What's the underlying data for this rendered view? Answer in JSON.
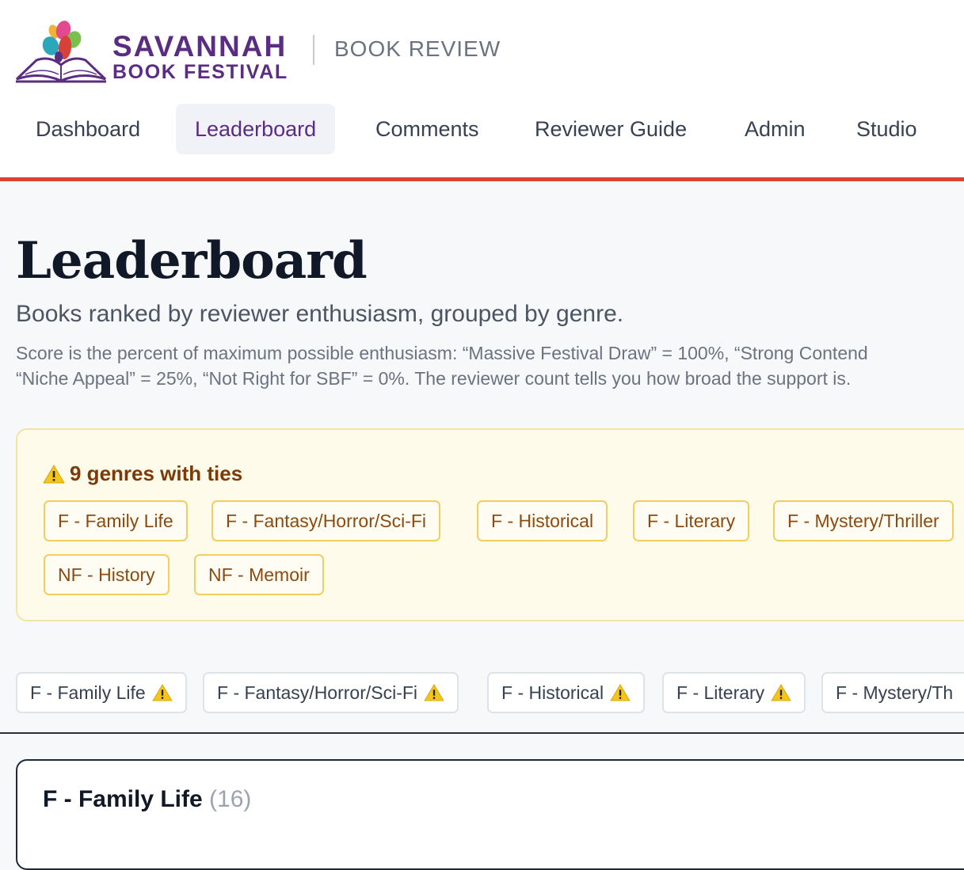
{
  "brand": {
    "line1": "SAVANNAH",
    "line2": "BOOK FESTIVAL",
    "section": "BOOK REVIEW",
    "color": "#5a2d82"
  },
  "nav": {
    "tabs": [
      {
        "label": "Dashboard",
        "active": false
      },
      {
        "label": "Leaderboard",
        "active": true
      },
      {
        "label": "Comments",
        "active": false
      },
      {
        "label": "Reviewer Guide",
        "active": false
      },
      {
        "label": "Admin",
        "active": false
      },
      {
        "label": "Studio",
        "active": false
      }
    ]
  },
  "page": {
    "title": "Leaderboard",
    "subtitle": "Books ranked by reviewer enthusiasm, grouped by genre.",
    "note_line1": "Score is the percent of maximum possible enthusiasm: “Massive Festival Draw” = 100%, “Strong Contend",
    "note_line2": "“Niche Appeal” = 25%, “Not Right for SBF” = 0%. The reviewer count tells you how broad the support is."
  },
  "ties": {
    "title": "9 genres with ties",
    "genres": [
      "F - Family Life",
      "F - Fantasy/Horror/Sci-Fi",
      "F - Historical",
      "F - Literary",
      "F - Mystery/Thriller",
      "NF - History",
      "NF - Memoir"
    ]
  },
  "genre_tabs": [
    "F - Family Life",
    "F - Fantasy/Horror/Sci-Fi",
    "F - Historical",
    "F - Literary",
    "F - Mystery/Th"
  ],
  "section": {
    "title": "F - Family Life",
    "count": "(16)"
  },
  "colors": {
    "accent": "#d9432f",
    "warning": "#f1cf5e",
    "warning_text": "#8a4a10"
  },
  "icons": {
    "warning": "warning-icon",
    "logo": "open-book-logo"
  }
}
